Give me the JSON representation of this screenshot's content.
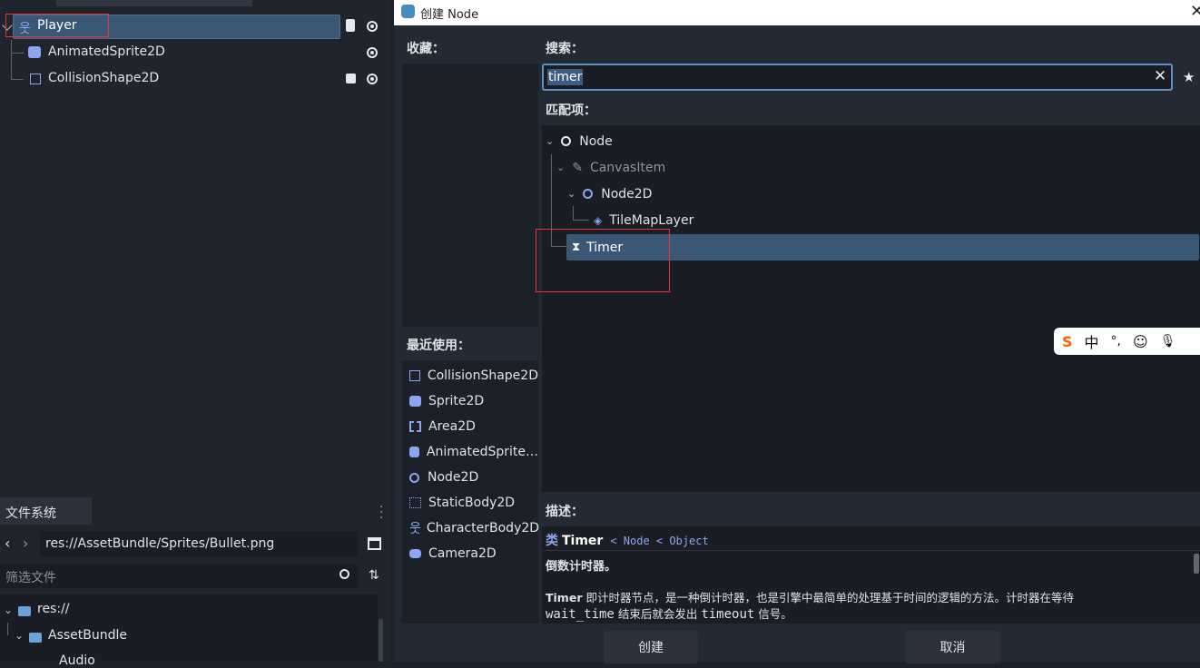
{
  "scene_tree": {
    "root": {
      "label": "Player",
      "icon": "character-body-icon"
    },
    "children": [
      {
        "label": "AnimatedSprite2D",
        "icon": "animated-sprite-icon"
      },
      {
        "label": "CollisionShape2D",
        "icon": "collision-shape-icon"
      }
    ]
  },
  "filesystem": {
    "tab_label": "文件系统",
    "path": "res://AssetBundle/Sprites/Bullet.png",
    "filter_placeholder": "筛选文件",
    "tree": [
      {
        "label": "res://"
      },
      {
        "label": "AssetBundle"
      },
      {
        "label": "Audio"
      }
    ]
  },
  "dialog": {
    "title": "创建 Node",
    "favorites_label": "收藏：",
    "search_label": "搜索：",
    "search_value": "timer",
    "matches_label": "匹配项：",
    "matches": [
      {
        "label": "Node",
        "icon": "node-icon"
      },
      {
        "label": "CanvasItem",
        "icon": "canvas-item-icon"
      },
      {
        "label": "Node2D",
        "icon": "node2d-icon"
      },
      {
        "label": "TileMapLayer",
        "icon": "tilemap-icon"
      },
      {
        "label": "Timer",
        "icon": "timer-icon"
      }
    ],
    "recent_label": "最近使用：",
    "recent": [
      {
        "label": "CollisionShape2D",
        "icon": "collision-shape-icon"
      },
      {
        "label": "Sprite2D",
        "icon": "sprite-icon"
      },
      {
        "label": "Area2D",
        "icon": "area-icon"
      },
      {
        "label": "AnimatedSprite…",
        "icon": "animated-sprite-icon"
      },
      {
        "label": "Node2D",
        "icon": "node2d-icon"
      },
      {
        "label": "StaticBody2D",
        "icon": "static-body-icon"
      },
      {
        "label": "CharacterBody2D",
        "icon": "character-body-icon"
      },
      {
        "label": "Camera2D",
        "icon": "camera-icon"
      }
    ],
    "desc_label": "描述：",
    "desc_class_prefix": "类",
    "desc_class": "Timer",
    "desc_inherits": "< Node < Object",
    "desc_brief": "倒数计时器。",
    "desc_body_name": "Timer",
    "desc_body_1": " 即计时器节点，是一种倒计时器，也是引擎中最简单的处理基于时间的逻辑的方法。计时器在等待",
    "desc_code_1": "wait_time",
    "desc_body_2": " 结束后就会发出 ",
    "desc_code_2": "timeout",
    "desc_body_3": " 信号。",
    "create_button": "创建",
    "cancel_button": "取消"
  },
  "ime_toolbar": {
    "mode": "中"
  },
  "colors": {
    "accent": "#3a5775",
    "highlight_border": "#e33333",
    "node_blue": "#8da5f3"
  }
}
